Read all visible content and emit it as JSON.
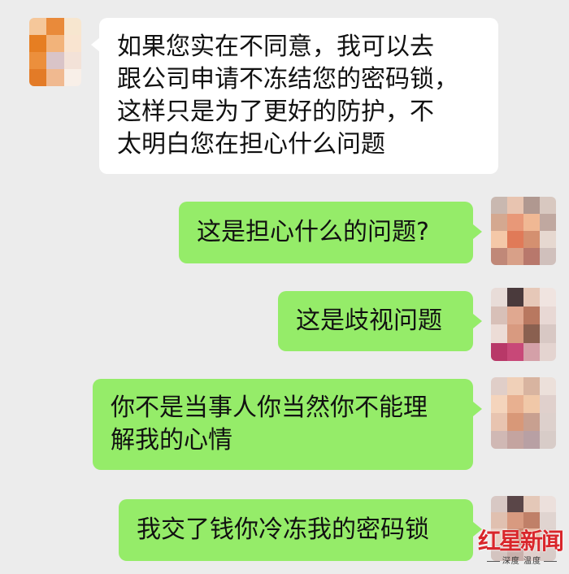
{
  "chat": {
    "messages": [
      {
        "direction": "incoming",
        "lines": [
          "如果您实在不同意，我可以去",
          "跟公司申请不冻结您的密码锁，",
          "这样只是为了更好的防护，不",
          "太明白您在担心什么问题"
        ]
      },
      {
        "direction": "outgoing",
        "lines": [
          "这是担心什么的问题?"
        ]
      },
      {
        "direction": "outgoing",
        "lines": [
          "这是歧视问题"
        ]
      },
      {
        "direction": "outgoing",
        "lines": [
          "你不是当事人你当然你不能理",
          "解我的心情"
        ]
      },
      {
        "direction": "outgoing",
        "lines": [
          "我交了钱你冷冻我的密码锁"
        ]
      }
    ]
  },
  "watermark": {
    "brand": "红星新闻",
    "tags": [
      "深度",
      "温度"
    ]
  },
  "colors": {
    "background": "#ececec",
    "incoming_bubble": "#ffffff",
    "outgoing_bubble": "#95ec69",
    "brand_red": "#d9262b"
  },
  "icons": {
    "incoming_avatar": "blurred-avatar-icon",
    "outgoing_avatar": "blurred-avatar-icon"
  }
}
